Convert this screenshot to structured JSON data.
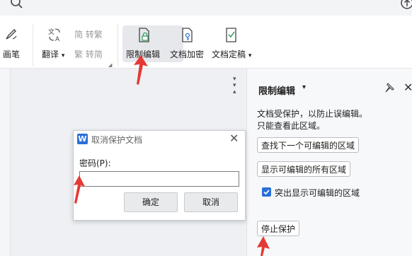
{
  "ribbon": {
    "draw_label": "画笔",
    "translate_label": "翻译",
    "to_traditional_label": "简 转繁",
    "to_simplified_label": "繁 转简",
    "restrict_edit_label": "限制编辑",
    "encrypt_label": "文档加密",
    "finalize_label": "文档定稿"
  },
  "panel": {
    "title": "限制编辑",
    "line1": "文档受保护，以防止误编辑。",
    "line2": "只能查看此区域。",
    "find_next_btn": "查找下一个可编辑的区域",
    "show_all_btn": "显示可编辑的所有区域",
    "highlight_checkbox_label": "突出显示可编辑的区域",
    "highlight_checked": true,
    "stop_protect_btn": "停止保护"
  },
  "dialog": {
    "title": "取消保护文档",
    "password_label": "密码(P):",
    "password_value": "",
    "ok_btn": "确定",
    "cancel_btn": "取消"
  },
  "colors": {
    "accent": "#2b6fd8",
    "annotation_arrow": "#e53935"
  }
}
